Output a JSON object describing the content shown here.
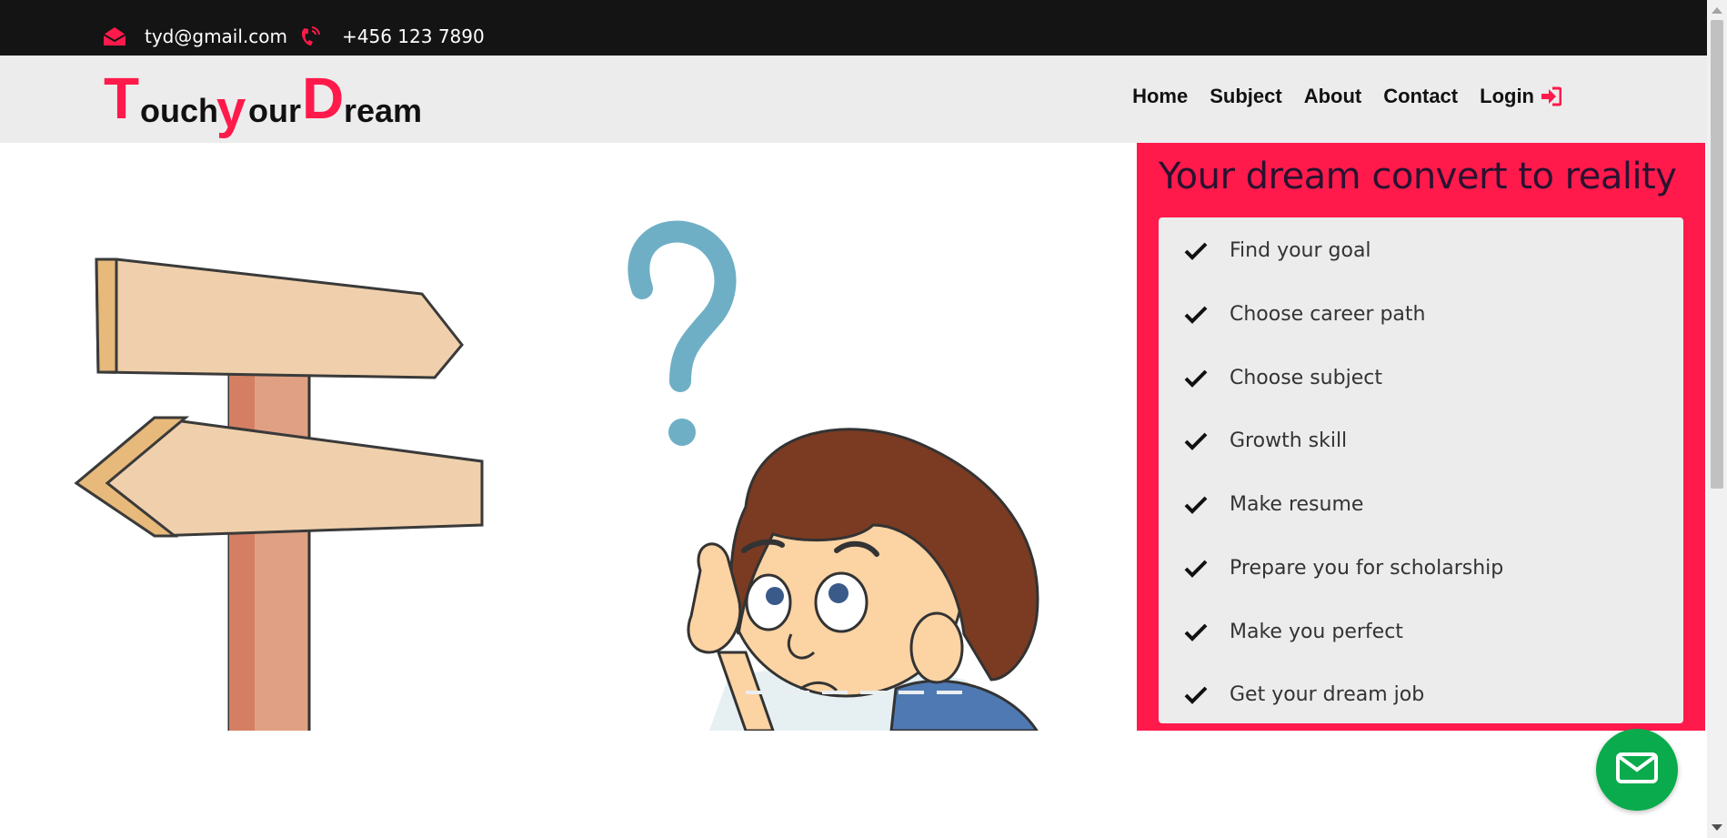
{
  "topbar": {
    "email": "tyd@gmail.com",
    "phone": "+456 123 7890"
  },
  "brand": {
    "logo_parts": [
      "T",
      "ouch",
      "y",
      "our",
      "D",
      "ream"
    ],
    "accent_color": "#ff1a4b"
  },
  "nav": {
    "items": [
      {
        "label": "Home"
      },
      {
        "label": "Subject"
      },
      {
        "label": "About"
      },
      {
        "label": "Contact"
      }
    ],
    "login_label": "Login"
  },
  "panel": {
    "title": "Your dream convert to reality",
    "items": [
      "Find your goal",
      "Choose career path",
      "Choose subject",
      "Growth skill",
      "Make resume",
      "Prepare you for scholarship",
      "Make you perfect",
      "Get your dream job"
    ]
  },
  "fab": {
    "icon": "mail-icon",
    "color": "#0aab4c"
  }
}
